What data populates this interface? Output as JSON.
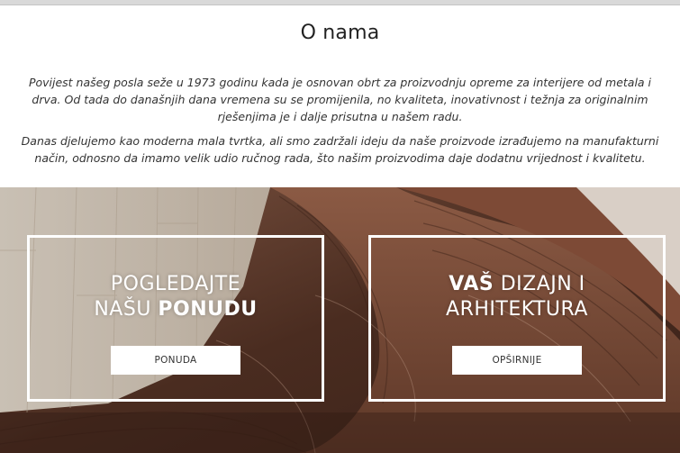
{
  "about": {
    "title": "O nama",
    "paragraph1": "Povijest našeg posla seže u 1973 godinu kada je osnovan obrt za proizvodnju opreme za interijere od metala i drva. Od tada do današnjih dana vremena su se promijenila, no kvaliteta, inovativnost i težnja za originalnim rješenjima je i dalje prisutna u našem radu.",
    "paragraph2": "Danas djelujemo kao moderna mala tvrtka, ali smo zadržali ideju da naše proizvode izrađujemo na manufakturni način, odnosno da imamo velik udio ručnog rada, što našim proizvodima daje dodatnu vrijednost i kvalitetu."
  },
  "cards": {
    "offer": {
      "line1": "POGLEDAJTE",
      "line2_plain": "NAŠU ",
      "line2_bold": "PONUDU",
      "button": "PONUDA"
    },
    "design": {
      "line1_bold": "VAŠ",
      "line1_plain": " DIZAJN I",
      "line2": "ARHITEKTURA",
      "button": "OPŠIRNIJE"
    }
  },
  "colors": {
    "border": "#ffffff",
    "wood_dark": "#5a3a2a",
    "wood_light": "#cbc2b6"
  }
}
